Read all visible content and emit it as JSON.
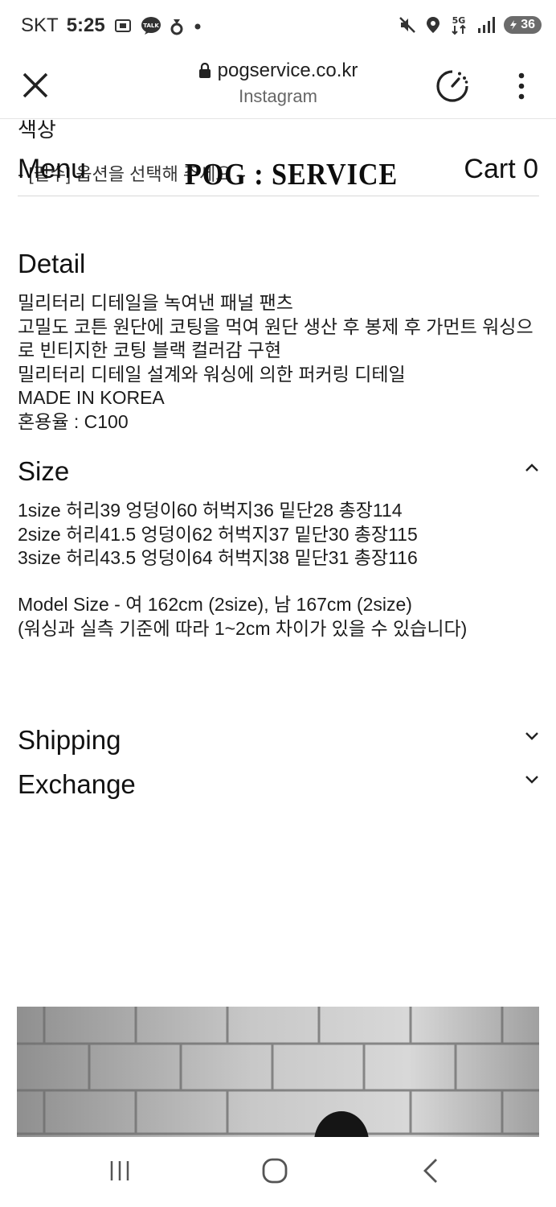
{
  "status_bar": {
    "carrier": "SKT",
    "time": "5:25",
    "battery": "36",
    "network": "5G",
    "icons": [
      "screenshot-icon",
      "kakaotalk-icon",
      "notification-app-icon",
      "dot-icon",
      "mute-icon",
      "location-icon",
      "network-5g-icon",
      "signal-icon",
      "battery-icon"
    ]
  },
  "browser": {
    "url": "pogservice.co.kr",
    "subtitle": "Instagram",
    "icons": [
      "close-icon",
      "lock-icon",
      "speed-icon",
      "more-vert-icon"
    ]
  },
  "page": {
    "color_label": "색상",
    "option_placeholder": "- [필수] 옵션을 선택해 주세요 -",
    "header": {
      "menu": "Menu",
      "brand": "POG : SERVICE",
      "cart": "Cart 0"
    },
    "detail": {
      "title": "Detail",
      "lines": [
        "밀리터리 디테일을 녹여낸 패널 팬츠",
        "고밀도 코튼 원단에 코팅을 먹여 원단 생산 후 봉제 후 가먼트 워싱으",
        "로 빈티지한 코팅 블랙 컬러감 구현",
        "밀리터리 디테일 설계와 워싱에 의한 퍼커링 디테일",
        "MADE IN KOREA",
        "혼용율 : C100"
      ]
    },
    "size": {
      "title": "Size",
      "lines": [
        "1size 허리39 엉덩이60 허벅지36 밑단28 총장114",
        "2size 허리41.5 엉덩이62 허벅지37 밑단30 총장115",
        "3size 허리43.5 엉덩이64 허벅지38 밑단31 총장116"
      ],
      "model_lines": [
        "Model Size - 여 162cm (2size), 남 167cm (2size)",
        "(워싱과 실측 기준에 따라 1~2cm 차이가 있을 수 있습니다)"
      ],
      "expanded": true
    },
    "shipping": {
      "title": "Shipping",
      "expanded": false
    },
    "exchange": {
      "title": "Exchange",
      "expanded": false
    }
  },
  "nav": {
    "icons": [
      "recent-apps-icon",
      "home-icon",
      "back-icon"
    ]
  },
  "colors": {
    "text": "#1a1a1a",
    "muted": "#666666",
    "divider": "#d8d8d8",
    "battery_bg": "#6b6b6b"
  }
}
